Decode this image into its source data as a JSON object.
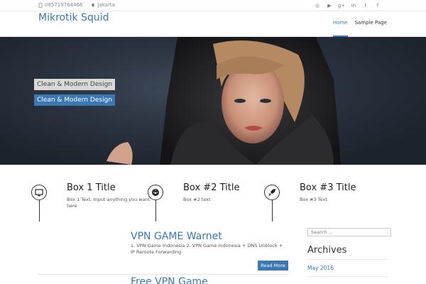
{
  "topbar": {
    "phone": "085719764466",
    "location": "Jakarta",
    "phone_icon": "phone-icon",
    "location_icon": "map-marker-icon",
    "socials": [
      "dribbble-icon",
      "youtube-icon",
      "google-plus-icon",
      "linkedin-icon",
      "twitter-icon",
      "facebook-icon"
    ]
  },
  "header": {
    "site_title": "Mikrotik Squid",
    "nav": [
      "Home",
      "Sample Page"
    ]
  },
  "hero": {
    "caption1": "Clean & Modern Design",
    "caption2": "Clean & Modern Design"
  },
  "features": [
    {
      "title": "Box 1 Title",
      "text": "Box 1 Text. Input anything you want here",
      "icon": "desktop-icon"
    },
    {
      "title": "Box #2 Title",
      "text": "Box #2 text",
      "icon": "dashboard-icon"
    },
    {
      "title": "Box #3 Title",
      "text": "Box #3 Text",
      "icon": "rocket-icon"
    }
  ],
  "posts": [
    {
      "title": "VPN GAME Warnet",
      "excerpt": "1. VPN Game Indonesia 2. VPN Game Indonesia + DNS Unblock + IP Remote Forwarding",
      "more": "Read More"
    },
    {
      "title": "Free VPN Game"
    }
  ],
  "sidebar": {
    "search_placeholder": "Search ...",
    "archives_title": "Archives",
    "archives": [
      "May 2016"
    ]
  },
  "colors": {
    "accent": "#3a78b5",
    "caption_bg": "#d9d9d9"
  }
}
